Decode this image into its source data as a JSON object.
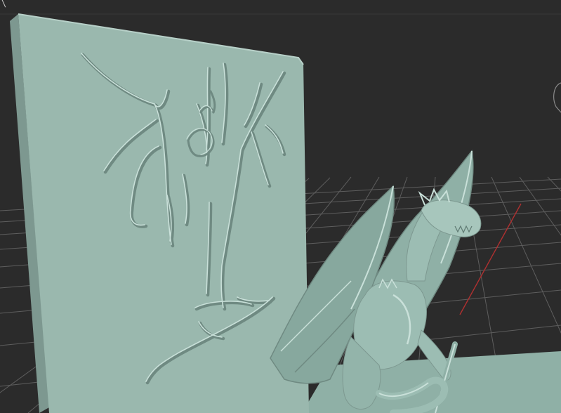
{
  "viewport": {
    "corner_mark": "\\",
    "colors": {
      "background": "#2b2b2b",
      "grid_line": "#5c5c5c",
      "grid_floor": "#3a3a3a",
      "axis_x": "#b03030",
      "model": "#9cbdb3",
      "model_shadow": "#7d9890",
      "model_highlight": "#c9e0d9"
    },
    "objects": [
      {
        "name": "relief-panel-tree"
      },
      {
        "name": "dragon-model"
      }
    ]
  }
}
